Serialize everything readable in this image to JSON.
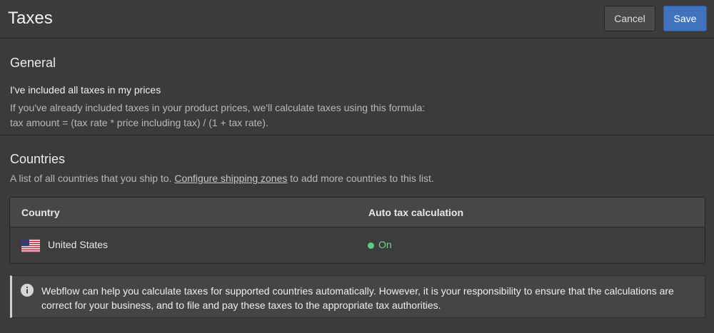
{
  "header": {
    "title": "Taxes",
    "cancel_label": "Cancel",
    "save_label": "Save"
  },
  "general": {
    "heading": "General",
    "checkbox_label": "I've included all taxes in my prices",
    "help_line1": "If you've already included taxes in your product prices, we'll calculate taxes using this formula:",
    "help_line2": "tax amount = (tax rate * price including tax) / (1 + tax rate)."
  },
  "countries": {
    "heading": "Countries",
    "description_prefix": "A list of all countries that you ship to.",
    "link_label": "Configure shipping zones",
    "description_suffix": "to add more countries to this list.",
    "columns": [
      "Country",
      "Auto tax calculation"
    ],
    "rows": [
      {
        "country": "United States",
        "flag_icon": "us-flag-icon",
        "auto_tax": "On",
        "status_color": "#5ecb7e"
      }
    ]
  },
  "notice": {
    "icon": "info-icon",
    "text": "Webflow can help you calculate taxes for supported countries automatically. However, it is your responsibility to ensure that the calculations are correct for your business, and to file and pay these taxes to the appropriate tax authorities."
  },
  "colors": {
    "accent": "#3f73c0",
    "background": "#3b3b3b",
    "status_on": "#5ecb7e"
  }
}
